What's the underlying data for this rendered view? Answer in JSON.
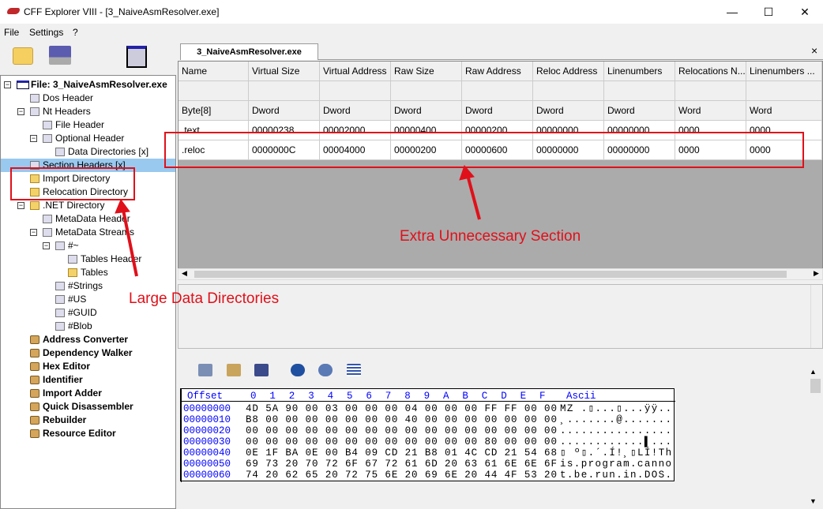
{
  "window": {
    "title": "CFF Explorer VIII - [3_NaiveAsmResolver.exe]",
    "minimize": "—",
    "maximize": "☐",
    "close": "✕"
  },
  "menu": [
    "File",
    "Settings",
    "?"
  ],
  "tab": {
    "label": "3_NaiveAsmResolver.exe",
    "close": "×"
  },
  "tree": [
    {
      "label": "File: 3_NaiveAsmResolver.exe",
      "level": 0,
      "icon": "win",
      "exp": true,
      "bold": true
    },
    {
      "label": "Dos Header",
      "level": 1,
      "icon": "doc"
    },
    {
      "label": "Nt Headers",
      "level": 1,
      "icon": "doc",
      "exp": true
    },
    {
      "label": "File Header",
      "level": 2,
      "icon": "doc"
    },
    {
      "label": "Optional Header",
      "level": 2,
      "icon": "doc",
      "exp": true
    },
    {
      "label": "Data Directories [x]",
      "level": 3,
      "icon": "doc"
    },
    {
      "label": "Section Headers [x]",
      "level": 1,
      "icon": "doc",
      "selected": true
    },
    {
      "label": "Import Directory",
      "level": 1,
      "icon": "folder"
    },
    {
      "label": "Relocation Directory",
      "level": 1,
      "icon": "folder"
    },
    {
      "label": ".NET Directory",
      "level": 1,
      "icon": "folder",
      "exp": true
    },
    {
      "label": "MetaData Header",
      "level": 2,
      "icon": "doc"
    },
    {
      "label": "MetaData Streams",
      "level": 2,
      "icon": "doc",
      "exp": true
    },
    {
      "label": "#~",
      "level": 3,
      "icon": "doc",
      "exp": true
    },
    {
      "label": "Tables Header",
      "level": 4,
      "icon": "doc"
    },
    {
      "label": "Tables",
      "level": 4,
      "icon": "folder"
    },
    {
      "label": "#Strings",
      "level": 3,
      "icon": "doc"
    },
    {
      "label": "#US",
      "level": 3,
      "icon": "doc"
    },
    {
      "label": "#GUID",
      "level": 3,
      "icon": "doc"
    },
    {
      "label": "#Blob",
      "level": 3,
      "icon": "doc"
    },
    {
      "label": "Address Converter",
      "level": 1,
      "icon": "tool",
      "bold": true
    },
    {
      "label": "Dependency Walker",
      "level": 1,
      "icon": "tool",
      "bold": true
    },
    {
      "label": "Hex Editor",
      "level": 1,
      "icon": "tool",
      "bold": true
    },
    {
      "label": "Identifier",
      "level": 1,
      "icon": "tool",
      "bold": true
    },
    {
      "label": "Import Adder",
      "level": 1,
      "icon": "tool",
      "bold": true
    },
    {
      "label": "Quick Disassembler",
      "level": 1,
      "icon": "tool",
      "bold": true
    },
    {
      "label": "Rebuilder",
      "level": 1,
      "icon": "tool",
      "bold": true
    },
    {
      "label": "Resource Editor",
      "level": 1,
      "icon": "tool",
      "bold": true
    }
  ],
  "sections": {
    "columns": [
      "Name",
      "Virtual Size",
      "Virtual Address",
      "Raw Size",
      "Raw Address",
      "Reloc Address",
      "Linenumbers",
      "Relocations N...",
      "Linenumbers ..."
    ],
    "types": [
      "Byte[8]",
      "Dword",
      "Dword",
      "Dword",
      "Dword",
      "Dword",
      "Dword",
      "Word",
      "Word"
    ],
    "rows": [
      [
        ".text",
        "00000238",
        "00002000",
        "00000400",
        "00000200",
        "00000000",
        "00000000",
        "0000",
        "0000"
      ],
      [
        ".reloc",
        "0000000C",
        "00004000",
        "00000200",
        "00000600",
        "00000000",
        "00000000",
        "0000",
        "0000"
      ]
    ]
  },
  "hex": {
    "offset_header": "Offset",
    "ascii_header": "Ascii",
    "columns": [
      "0",
      "1",
      "2",
      "3",
      "4",
      "5",
      "6",
      "7",
      "8",
      "9",
      "A",
      "B",
      "C",
      "D",
      "E",
      "F"
    ],
    "rows": [
      {
        "offset": "00000000",
        "bytes": "4D 5A 90 00 03 00 00 00 04 00 00 00 FF FF 00 00",
        "ascii": "MZ .▯...▯...ÿÿ.."
      },
      {
        "offset": "00000010",
        "bytes": "B8 00 00 00 00 00 00 00 40 00 00 00 00 00 00 00",
        "ascii": "¸.......@......."
      },
      {
        "offset": "00000020",
        "bytes": "00 00 00 00 00 00 00 00 00 00 00 00 00 00 00 00",
        "ascii": "................"
      },
      {
        "offset": "00000030",
        "bytes": "00 00 00 00 00 00 00 00 00 00 00 00 80 00 00 00",
        "ascii": "............▌..."
      },
      {
        "offset": "00000040",
        "bytes": "0E 1F BA 0E 00 B4 09 CD 21 B8 01 4C CD 21 54 68",
        "ascii": "▯ º▯.´.Í!¸▯LÍ!Th"
      },
      {
        "offset": "00000050",
        "bytes": "69 73 20 70 72 6F 67 72 61 6D 20 63 61 6E 6E 6F",
        "ascii": "is.program.canno"
      },
      {
        "offset": "00000060",
        "bytes": "74 20 62 65 20 72 75 6E 20 69 6E 20 44 4F 53 20",
        "ascii": "t.be.run.in.DOS."
      }
    ]
  },
  "annotations": {
    "section_note": "Extra Unnecessary Section",
    "dir_note": "Large Data Directories",
    "color": "#e0101a"
  }
}
